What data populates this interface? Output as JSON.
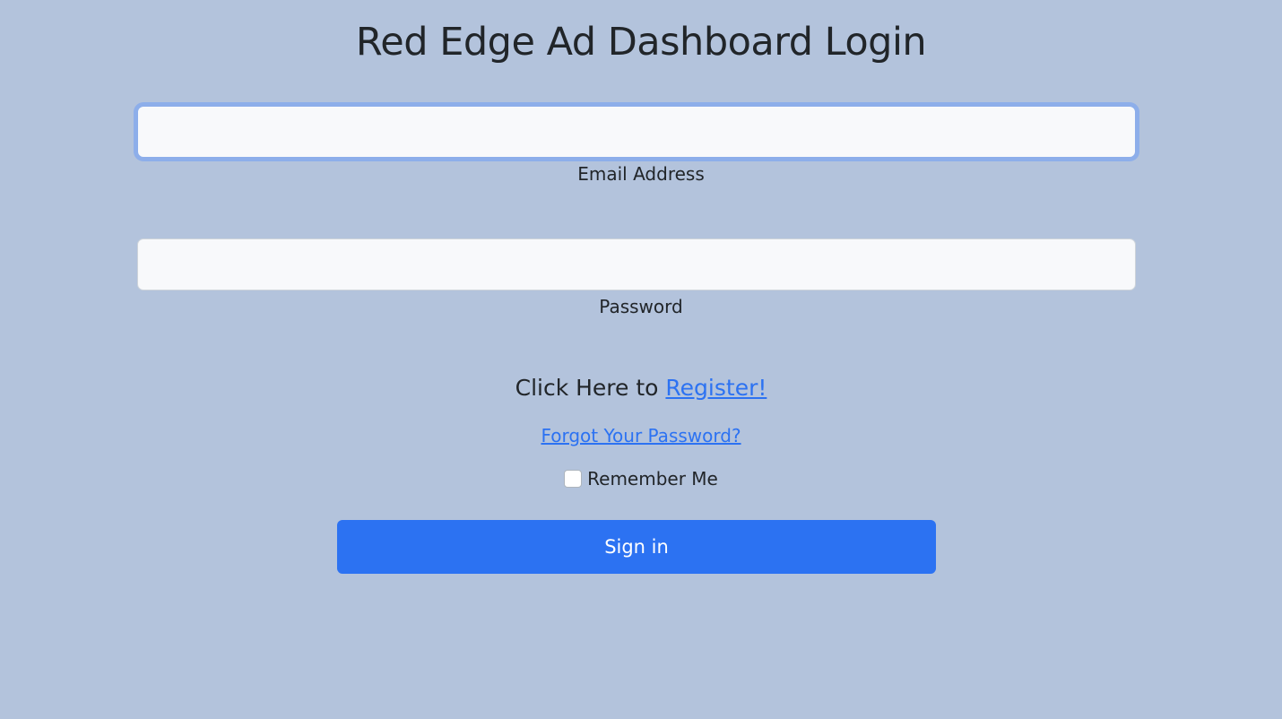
{
  "title": "Red Edge Ad Dashboard Login",
  "email": {
    "label": "Email Address",
    "value": ""
  },
  "password": {
    "label": "Password",
    "value": ""
  },
  "register": {
    "prefix": "Click Here to ",
    "link": "Register!"
  },
  "forgot": "Forgot Your Password?",
  "remember": {
    "label": "Remember Me",
    "checked": false
  },
  "signin": "Sign in"
}
